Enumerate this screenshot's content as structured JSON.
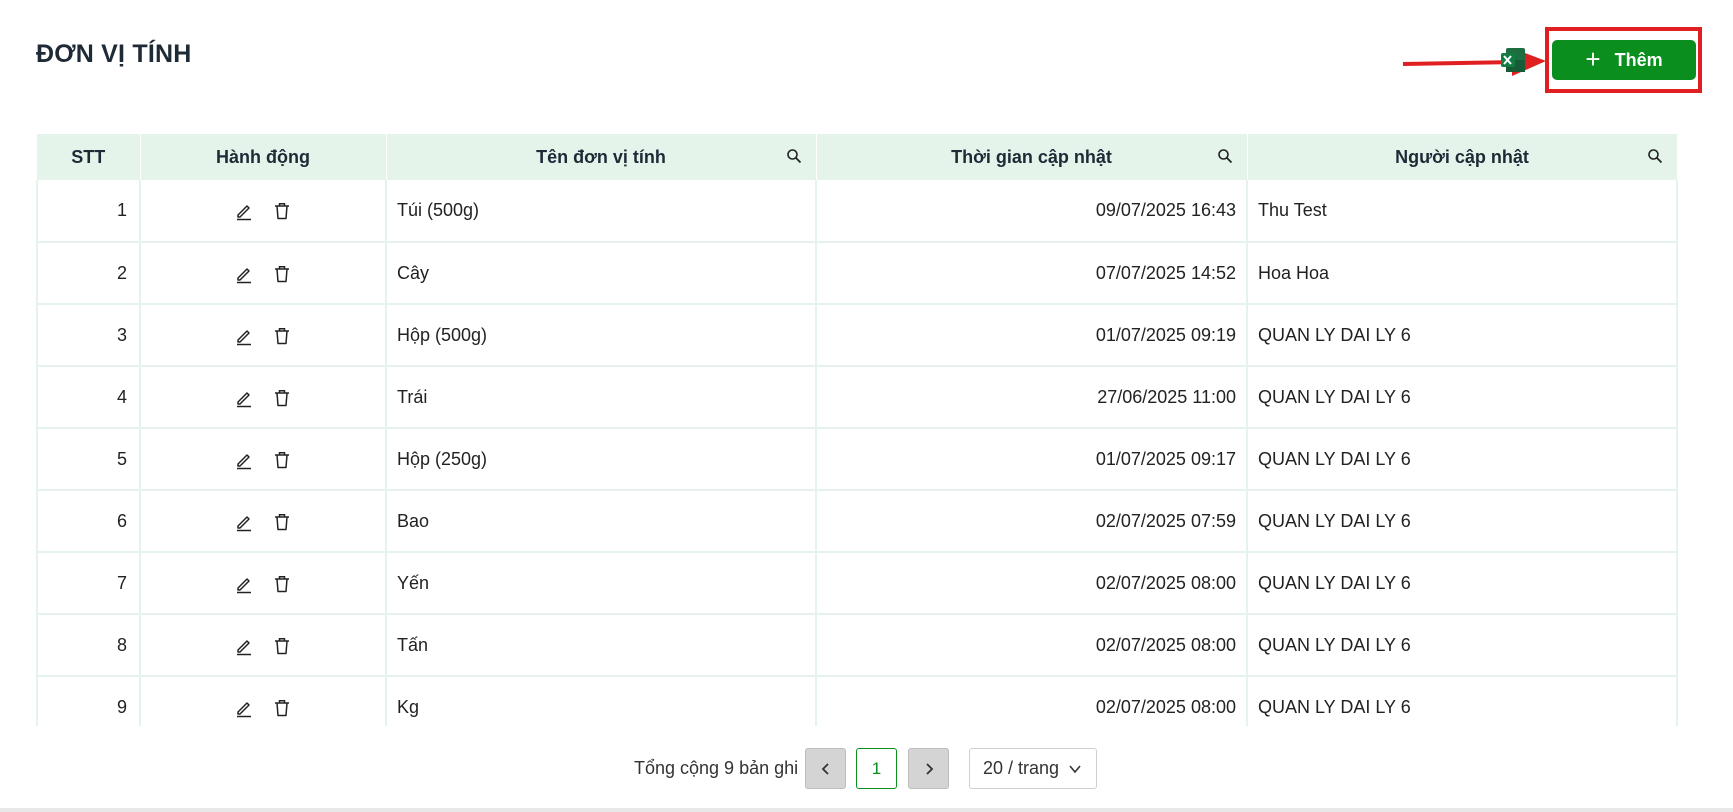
{
  "header": {
    "title": "ĐƠN VỊ TÍNH"
  },
  "toolbar": {
    "excel_icon": "excel-icon",
    "add_label": "Thêm",
    "add_icon": "plus-icon"
  },
  "table": {
    "columns": [
      "STT",
      "Hành động",
      "Tên đơn vị tính",
      "Thời gian cập nhật",
      "Người cập nhật"
    ],
    "rows": [
      {
        "stt": "1",
        "name": "Túi (500g)",
        "time": "09/07/2025 16:43",
        "user": "Thu Test"
      },
      {
        "stt": "2",
        "name": "Cây",
        "time": "07/07/2025 14:52",
        "user": "Hoa Hoa"
      },
      {
        "stt": "3",
        "name": "Hộp (500g)",
        "time": "01/07/2025 09:19",
        "user": "QUAN LY DAI LY 6"
      },
      {
        "stt": "4",
        "name": "Trái",
        "time": "27/06/2025 11:00",
        "user": "QUAN LY DAI LY 6"
      },
      {
        "stt": "5",
        "name": "Hộp (250g)",
        "time": "01/07/2025 09:17",
        "user": "QUAN LY DAI LY 6"
      },
      {
        "stt": "6",
        "name": "Bao",
        "time": "02/07/2025 07:59",
        "user": "QUAN LY DAI LY 6"
      },
      {
        "stt": "7",
        "name": "Yến",
        "time": "02/07/2025 08:00",
        "user": "QUAN LY DAI LY 6"
      },
      {
        "stt": "8",
        "name": "Tấn",
        "time": "02/07/2025 08:00",
        "user": "QUAN LY DAI LY 6"
      },
      {
        "stt": "9",
        "name": "Kg",
        "time": "02/07/2025 08:00",
        "user": "QUAN LY DAI LY 6"
      }
    ]
  },
  "pagination": {
    "total_text": "Tổng cộng 9 bản ghi",
    "current_page": "1",
    "page_size": "20 / trang"
  },
  "colors": {
    "accent": "#0a8f1e",
    "header_bg": "#e4f4ea",
    "highlight": "#e02020"
  }
}
